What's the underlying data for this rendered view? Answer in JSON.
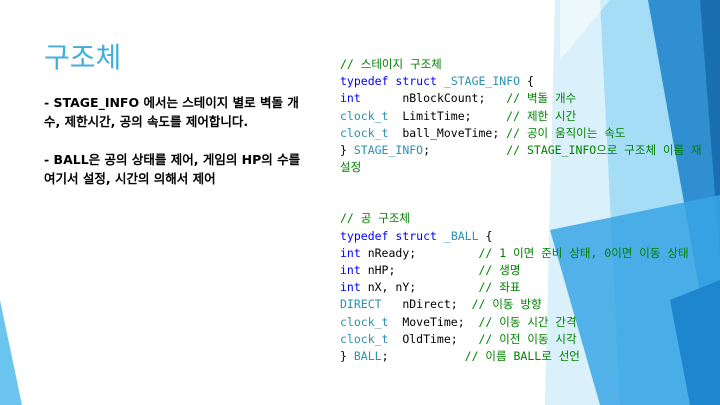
{
  "slide": {
    "title": "구조체",
    "bullets": [
      "- STAGE_INFO 에서는 스테이지 별로 벽돌 개수, 제한시간, 공의 속도를 제어합니다.",
      "- BALL은 공의 상태를 제어, 게임의 HP의 수를 여기서 설정, 시간의 의해서 제어"
    ],
    "colors": {
      "title": "#41aee0",
      "comment": "#008000",
      "keyword": "#0000ff",
      "type": "#2b91af",
      "accent": "#1f97d4"
    }
  },
  "code": {
    "block1": [
      [
        {
          "t": "// 스테이지 구조체",
          "c": "c"
        }
      ],
      [
        {
          "t": "typedef",
          "c": "k"
        },
        {
          "t": " "
        },
        {
          "t": "struct",
          "c": "k"
        },
        {
          "t": " "
        },
        {
          "t": "_STAGE_INFO",
          "c": "t"
        },
        {
          "t": " {"
        }
      ],
      [
        {
          "t": "int",
          "c": "k"
        },
        {
          "t": "      nBlockCount;   "
        },
        {
          "t": "// 벽돌 개수",
          "c": "c"
        }
      ],
      [
        {
          "t": "clock_t",
          "c": "t"
        },
        {
          "t": "  LimitTime;     "
        },
        {
          "t": "// 제한 시간",
          "c": "c"
        }
      ],
      [
        {
          "t": "clock_t",
          "c": "t"
        },
        {
          "t": "  ball_MoveTime; "
        },
        {
          "t": "// 공이 움직이는 속도",
          "c": "c"
        }
      ],
      [
        {
          "t": "} "
        },
        {
          "t": "STAGE_INFO",
          "c": "t"
        },
        {
          "t": ";           "
        },
        {
          "t": "// STAGE_INFO으로 구조체 이름 재설정",
          "c": "c"
        }
      ]
    ],
    "block2": [
      [
        {
          "t": "// 공 구조체",
          "c": "c"
        }
      ],
      [
        {
          "t": "typedef",
          "c": "k"
        },
        {
          "t": " "
        },
        {
          "t": "struct",
          "c": "k"
        },
        {
          "t": " "
        },
        {
          "t": "_BALL",
          "c": "t"
        },
        {
          "t": " {"
        }
      ],
      [
        {
          "t": "int",
          "c": "k"
        },
        {
          "t": " nReady;         "
        },
        {
          "t": "// 1 이면 준비 상태, 0이면 이동 상태",
          "c": "c"
        }
      ],
      [
        {
          "t": "int",
          "c": "k"
        },
        {
          "t": " nHP;            "
        },
        {
          "t": "// 생명",
          "c": "c"
        }
      ],
      [
        {
          "t": "int",
          "c": "k"
        },
        {
          "t": " nX, nY;         "
        },
        {
          "t": "// 좌표",
          "c": "c"
        }
      ],
      [
        {
          "t": "DIRECT",
          "c": "t"
        },
        {
          "t": "   nDirect;  "
        },
        {
          "t": "// 이동 방향",
          "c": "c"
        }
      ],
      [
        {
          "t": "clock_t",
          "c": "t"
        },
        {
          "t": "  MoveTime;  "
        },
        {
          "t": "// 이동 시간 간격",
          "c": "c"
        }
      ],
      [
        {
          "t": "clock_t",
          "c": "t"
        },
        {
          "t": "  OldTime;   "
        },
        {
          "t": "// 이전 이동 시각",
          "c": "c"
        }
      ],
      [
        {
          "t": "} "
        },
        {
          "t": "BALL",
          "c": "t"
        },
        {
          "t": ";           "
        },
        {
          "t": "// 이름 BALL로 선언",
          "c": "c"
        }
      ]
    ]
  }
}
